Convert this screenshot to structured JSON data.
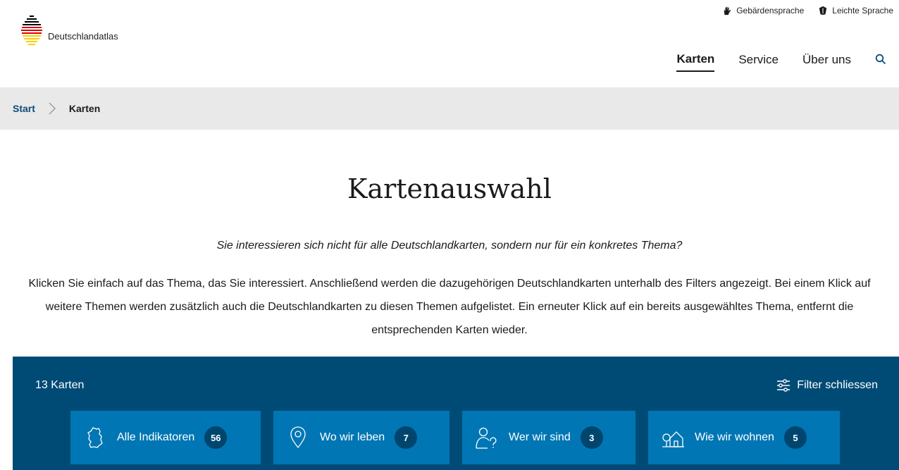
{
  "utility": {
    "sign_language": "Gebärdensprache",
    "easy_language": "Leichte Sprache"
  },
  "logo": {
    "name": "Deutschlandatlas"
  },
  "nav": {
    "items": [
      "Karten",
      "Service",
      "Über uns"
    ],
    "active": "Karten"
  },
  "breadcrumb": {
    "start": "Start",
    "current": "Karten"
  },
  "page": {
    "title": "Kartenauswahl",
    "question": "Sie interessieren sich nicht für alle Deutschlandkarten, sondern nur für ein konkretes Thema?",
    "description": "Klicken Sie einfach auf das Thema, das Sie interessiert. Anschließend werden die dazugehörigen Deutschlandkarten unterhalb des Filters angezeigt. Bei einem Klick auf weitere Themen werden zusätzlich auch die Deutschlandkarten zu diesen Themen aufgelistet. Ein erneuter Klick auf ein bereits ausgewähltes Thema, entfernt die entsprechenden Karten wieder."
  },
  "filter": {
    "count_label": "13 Karten",
    "toggle_label": "Filter schliessen",
    "themes": [
      {
        "label": "Alle Indikatoren",
        "count": "56",
        "icon": "germany-map-icon"
      },
      {
        "label": "Wo wir leben",
        "count": "7",
        "icon": "location-pin-icon"
      },
      {
        "label": "Wer wir sind",
        "count": "3",
        "icon": "person-question-icon"
      },
      {
        "label": "Wie wir wohnen",
        "count": "5",
        "icon": "houses-icon"
      }
    ]
  },
  "colors": {
    "panel": "#004b76",
    "tile": "#0076b4",
    "badge": "#00456d",
    "link": "#0a4c79",
    "breadcrumb_bg": "#e9e9e9"
  }
}
